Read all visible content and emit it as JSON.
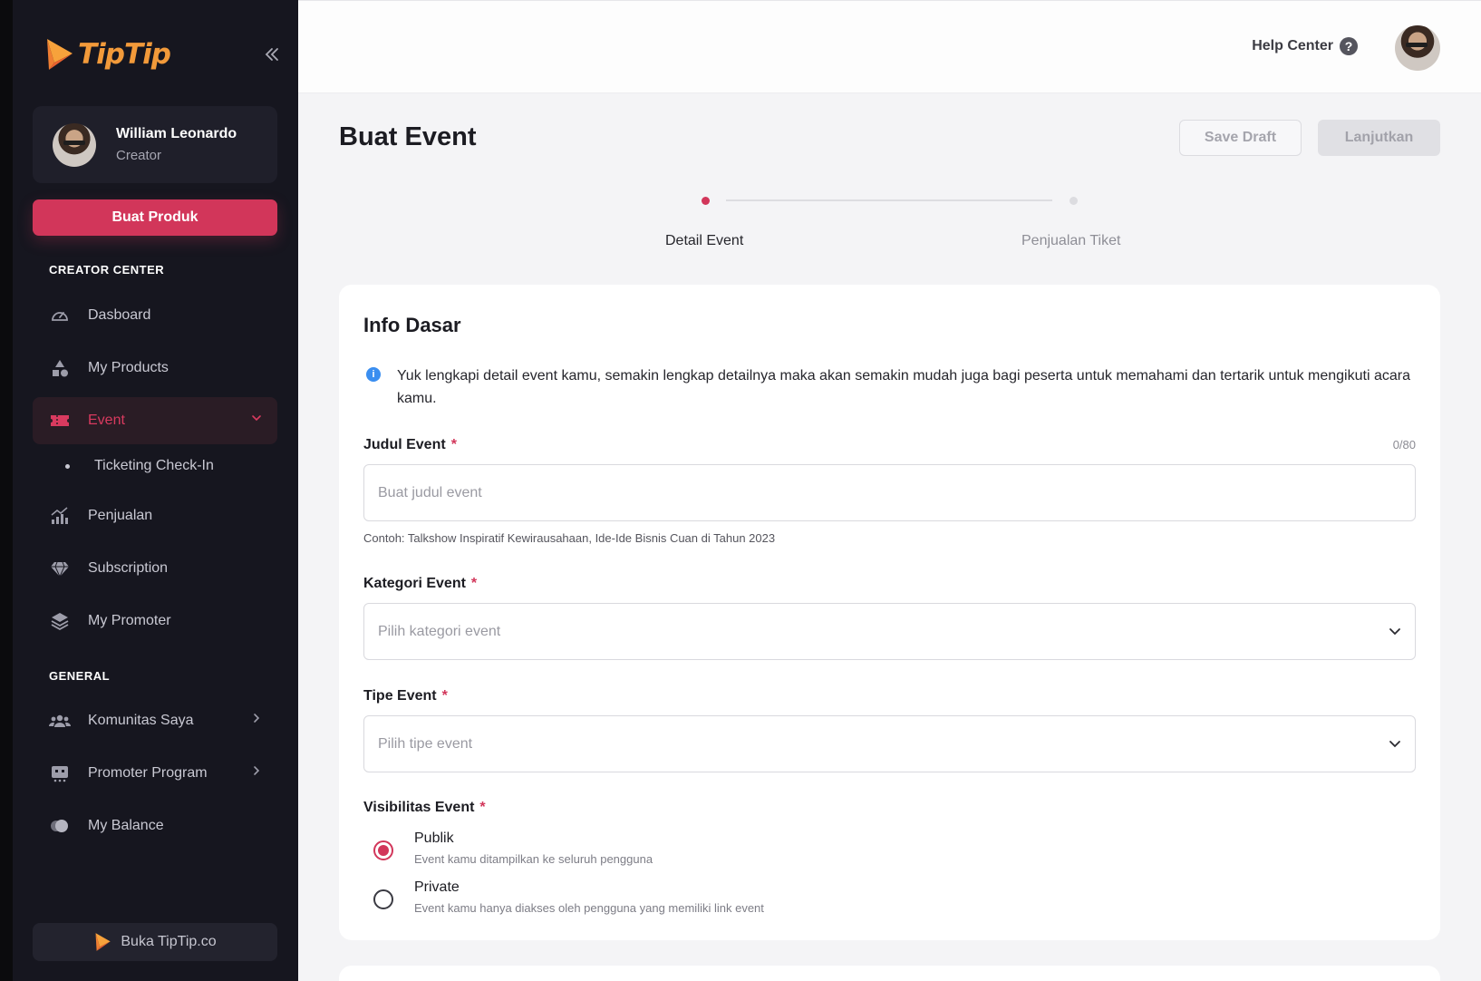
{
  "brand": {
    "name": "TipTip",
    "color": "#f29a3a",
    "accent": "#d2365a"
  },
  "sidebar": {
    "collapse_icon": "double-chevron-left-icon",
    "profile": {
      "name": "William Leonardo",
      "role": "Creator"
    },
    "create_button": "Buat Produk",
    "creator_center_title": "CREATOR CENTER",
    "creator_items": [
      {
        "label": "Dasboard",
        "icon": "gauge-icon"
      },
      {
        "label": "My Products",
        "icon": "shapes-icon"
      },
      {
        "label": "Event",
        "icon": "ticket-icon",
        "active": true,
        "expanded": true
      },
      {
        "label": "Ticketing Check-In",
        "icon": "dot-icon",
        "sub": true
      },
      {
        "label": "Penjualan",
        "icon": "chart-bars-icon"
      },
      {
        "label": "Subscription",
        "icon": "diamond-icon"
      },
      {
        "label": "My Promoter",
        "icon": "layers-icon"
      }
    ],
    "general_title": "GENERAL",
    "general_items": [
      {
        "label": "Komunitas Saya",
        "icon": "users-icon"
      },
      {
        "label": "Promoter Program",
        "icon": "robot-icon"
      },
      {
        "label": "My Balance",
        "icon": "coins-icon"
      }
    ],
    "open_site_button": "Buka TipTip.co"
  },
  "topbar": {
    "help_label": "Help Center",
    "help_icon": "question-circle-icon"
  },
  "page": {
    "title": "Buat Event",
    "save_draft": "Save Draft",
    "next": "Lanjutkan",
    "steps": [
      {
        "label": "Detail Event",
        "active": true
      },
      {
        "label": "Penjualan Tiket",
        "active": false
      }
    ]
  },
  "form": {
    "section_title": "Info Dasar",
    "info_text": "Yuk lengkapi detail event kamu, semakin lengkap detailnya maka akan semakin mudah juga bagi peserta untuk memahami dan tertarik untuk mengikuti acara kamu.",
    "required_mark": "*",
    "title_field": {
      "label": "Judul Event",
      "counter": "0/80",
      "placeholder": "Buat judul event",
      "value": "",
      "hint": "Contoh: Talkshow Inspiratif Kewirausahaan, Ide-Ide Bisnis Cuan di Tahun 2023"
    },
    "category_field": {
      "label": "Kategori Event",
      "placeholder": "Pilih kategori event"
    },
    "type_field": {
      "label": "Tipe Event",
      "placeholder": "Pilih tipe event"
    },
    "visibility_field": {
      "label": "Visibilitas Event",
      "options": [
        {
          "label": "Publik",
          "description": "Event kamu ditampilkan ke seluruh pengguna",
          "checked": true
        },
        {
          "label": "Private",
          "description": "Event kamu hanya diakses oleh pengguna yang memiliki link event",
          "checked": false
        }
      ]
    }
  }
}
